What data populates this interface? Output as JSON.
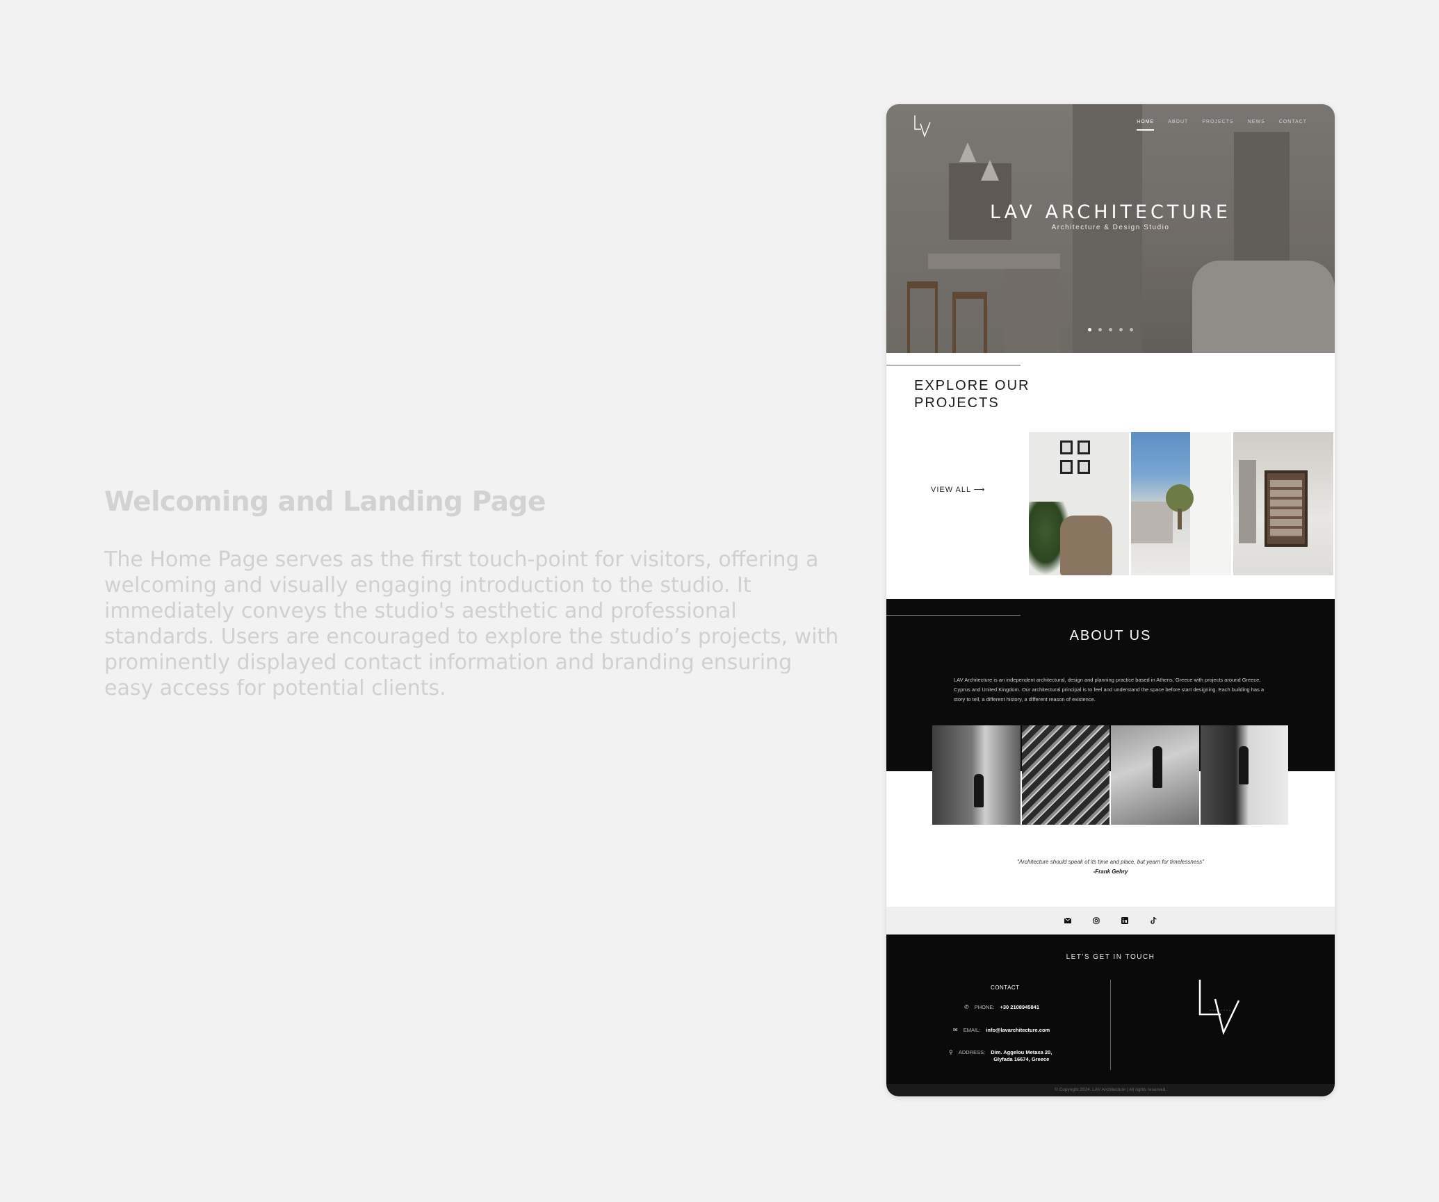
{
  "left": {
    "heading": "Welcoming and Landing Page",
    "body": "The Home Page serves as the first touch-point for visitors, offering a welcoming and visually engaging introduction to the studio. It immediately conveys the studio's aesthetic and professional standards. Users are encouraged to explore the studio’s projects, with prominently displayed contact information and branding ensuring easy access for potential clients."
  },
  "nav": {
    "items": [
      "HOME",
      "ABOUT",
      "PROJECTS",
      "NEWS",
      "CONTACT"
    ],
    "active": "HOME"
  },
  "hero": {
    "title": "LAV ARCHITECTURE",
    "subtitle": "Architecture & Design Studio",
    "slide_count": 5,
    "active_slide": 1
  },
  "explore": {
    "title": "EXPLORE OUR PROJECTS",
    "view_all": "VIEW ALL ⟶"
  },
  "about": {
    "title": "ABOUT US",
    "text": "LAV Architecture is an independent architectural, design and planning practice based in Athens, Greece with projects around Greece, Cyprus and United Kingdom. Our architectural principal is to feel and understand the space before start designing. Each building has a story to tell, a different history, a different reason of existence.",
    "quote": "\"Architecture should speak of its time and place, but yearn for timelessness\"",
    "quote_author": "-Frank Gehry"
  },
  "social": {
    "icons": [
      "email-icon",
      "instagram-icon",
      "linkedin-icon",
      "tiktok-icon"
    ]
  },
  "footer": {
    "touch": "LET'S GET IN TOUCH",
    "contact_heading": "CONTACT",
    "phone_label": "PHONE:",
    "phone": "+30 2108945841",
    "email_label": "EMAIL:",
    "email": "info@lavarchitecture.com",
    "address_label": "ADDRESS:",
    "address_line1": "Dim. Aggelou Metaxa 20,",
    "address_line2": "Glyfada 16674, Greece",
    "copyright": "© Copyright 2024. LAV Architecture | All rights reserved."
  }
}
